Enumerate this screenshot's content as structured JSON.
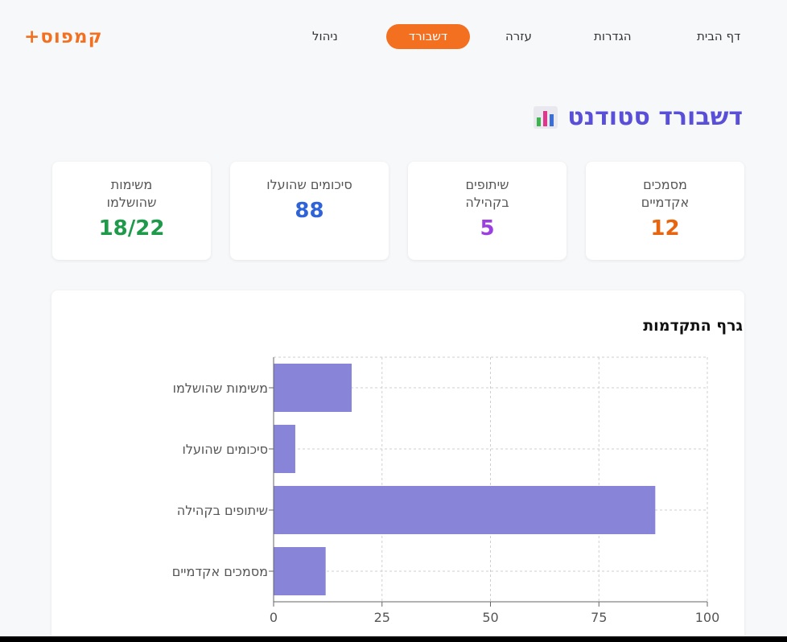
{
  "nav": {
    "items": [
      {
        "label": "דף הבית"
      },
      {
        "label": "הגדרות"
      },
      {
        "label": "עזרה"
      },
      {
        "label": "דשבורד",
        "active": true
      },
      {
        "label": "ניהול"
      }
    ],
    "logo": "+קמפוס",
    "accent": "#f37021"
  },
  "page": {
    "title": "דשבורד סטודנט",
    "title_icon": "bar-chart-icon",
    "title_color": "#5a4fd8"
  },
  "stats": [
    {
      "label_line1": "מסמכים",
      "label_line2": "אקדמיים",
      "value": "12",
      "color": "#e8650f"
    },
    {
      "label_line1": "שיתופים",
      "label_line2": "בקהילה",
      "value": "5",
      "color": "#9b3fe0"
    },
    {
      "label_line1": "סיכומים שהועלו",
      "label_line2": "",
      "value": "88",
      "color": "#2f63d8"
    },
    {
      "label_line1": "משימות",
      "label_line2": "שהושלמו",
      "value": "18/22",
      "color": "#1f9a4a"
    }
  ],
  "chart_data": {
    "type": "bar",
    "orientation": "horizontal",
    "title": "גרף התקדמות",
    "categories": [
      "משימות שהושלמו",
      "סיכומים שהועלו",
      "שיתופים בקהילה",
      "מסמכים אקדמיים"
    ],
    "values": [
      18,
      5,
      88,
      12
    ],
    "xlim": [
      0,
      100
    ],
    "xticks": [
      0,
      25,
      50,
      75,
      100
    ],
    "grid": true,
    "bar_color": "#8884d8"
  }
}
